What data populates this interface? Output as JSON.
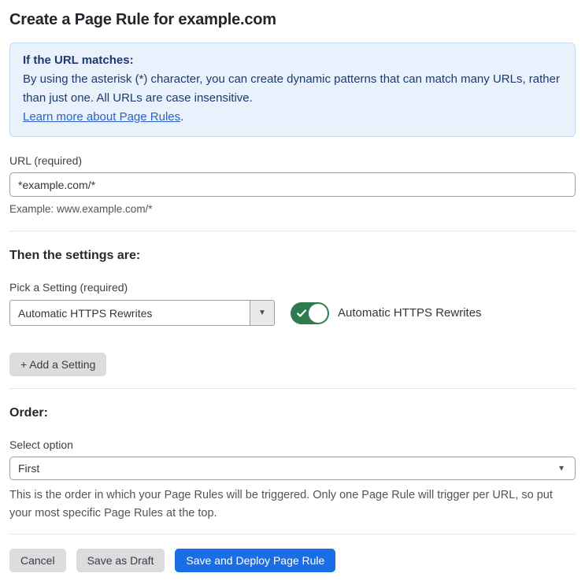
{
  "page": {
    "title": "Create a Page Rule for example.com"
  },
  "info_box": {
    "heading": "If the URL matches:",
    "body": "By using the asterisk (*) character, you can create dynamic patterns that can match many URLs, rather than just one. All URLs are case insensitive.",
    "link_label": "Learn more about Page Rules",
    "link_suffix": "."
  },
  "url_field": {
    "label": "URL (required)",
    "value": "*example.com/*",
    "helper": "Example: www.example.com/*"
  },
  "settings_section": {
    "heading": "Then the settings are:",
    "picker_label": "Pick a Setting (required)",
    "picker_value": "Automatic HTTPS Rewrites",
    "toggle_label": "Automatic HTTPS Rewrites",
    "toggle_state": "on",
    "add_setting_label": "+ Add a Setting"
  },
  "order_section": {
    "heading": "Order:",
    "select_label": "Select option",
    "select_value": "First",
    "helper": "This is the order in which your Page Rules will be triggered. Only one Page Rule will trigger per URL, so put your most specific Page Rules at the top."
  },
  "actions": {
    "cancel": "Cancel",
    "save_draft": "Save as Draft",
    "save_deploy": "Save and Deploy Page Rule"
  },
  "icons": {
    "caret_down": "▼"
  },
  "colors": {
    "accent_blue": "#1a6ee5",
    "toggle_green": "#2e7b4f",
    "info_bg": "#e9f2fc",
    "info_border": "#c3dcf3",
    "info_text": "#1d3a6e",
    "link_blue": "#2d61c8",
    "button_gray": "#dcdcde",
    "border_gray": "#9aa0a7"
  }
}
